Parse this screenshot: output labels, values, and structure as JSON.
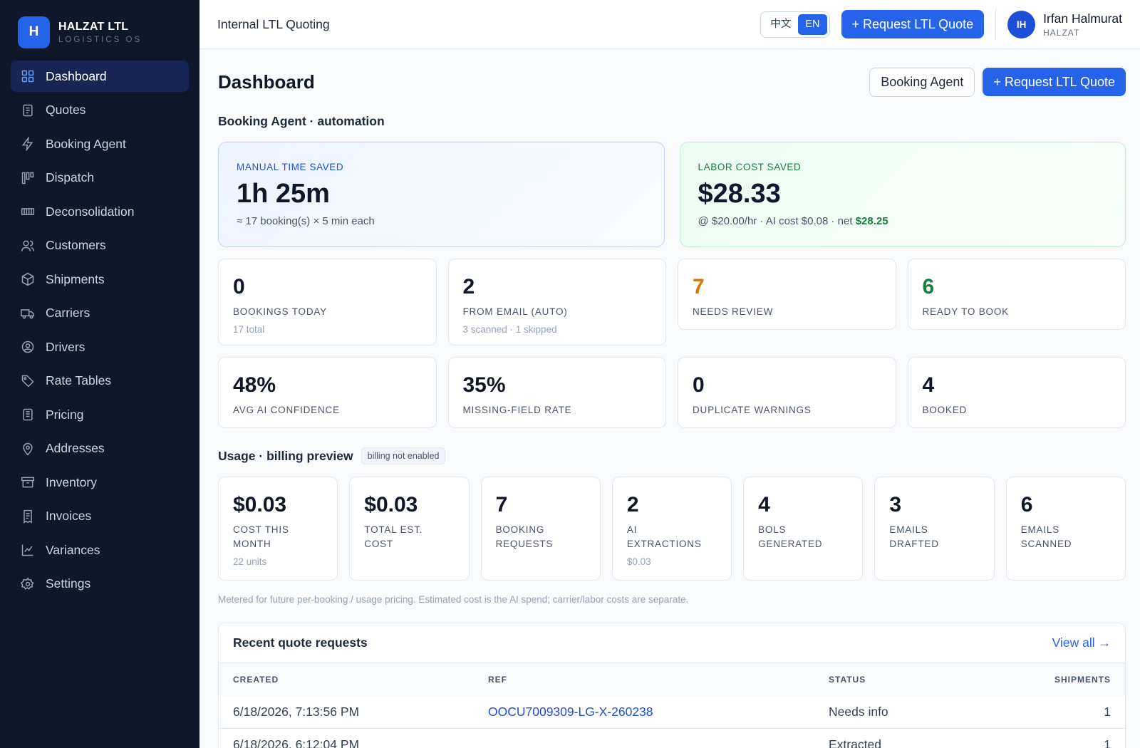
{
  "brand": {
    "logo_letter": "H",
    "name": "HALZAT LTL",
    "sub": "LOGISTICS OS"
  },
  "sidebar": {
    "items": [
      {
        "label": "Dashboard",
        "icon": "grid-icon",
        "active": true
      },
      {
        "label": "Quotes",
        "icon": "document-icon"
      },
      {
        "label": "Booking Agent",
        "icon": "lightning-icon"
      },
      {
        "label": "Dispatch",
        "icon": "kanban-icon"
      },
      {
        "label": "Deconsolidation",
        "icon": "barcode-icon"
      },
      {
        "label": "Customers",
        "icon": "users-icon"
      },
      {
        "label": "Shipments",
        "icon": "box-icon"
      },
      {
        "label": "Carriers",
        "icon": "truck-icon"
      },
      {
        "label": "Drivers",
        "icon": "driver-icon"
      },
      {
        "label": "Rate Tables",
        "icon": "tag-icon"
      },
      {
        "label": "Pricing",
        "icon": "list-icon"
      },
      {
        "label": "Addresses",
        "icon": "pin-icon"
      },
      {
        "label": "Inventory",
        "icon": "archive-icon"
      },
      {
        "label": "Invoices",
        "icon": "receipt-icon"
      },
      {
        "label": "Variances",
        "icon": "line-chart-icon"
      },
      {
        "label": "Settings",
        "icon": "gear-icon"
      }
    ]
  },
  "topbar": {
    "title": "Internal LTL Quoting",
    "lang_zh": "中文",
    "lang_en": "EN",
    "request_button": "+ Request LTL Quote",
    "user": {
      "initials": "IH",
      "name": "Irfan Halmurat",
      "org": "HALZAT"
    }
  },
  "page": {
    "title": "Dashboard",
    "booking_agent_button": "Booking Agent",
    "request_button": "+ Request LTL Quote",
    "automation_title": "Booking Agent · automation",
    "hero": {
      "time": {
        "label": "MANUAL TIME SAVED",
        "value": "1h 25m",
        "sub": "≈ 17 booking(s) × 5 min each"
      },
      "cost": {
        "label": "LABOR COST SAVED",
        "value": "$28.33",
        "sub": "@ $20.00/hr · AI cost $0.08 · net ",
        "net": "$28.25"
      }
    },
    "stats_row1": [
      {
        "value": "0",
        "label": "Bookings today",
        "sub": "17 total",
        "color": "#0f172a"
      },
      {
        "value": "2",
        "label": "From email (auto)",
        "sub": "3 scanned · 1 skipped",
        "color": "#0f172a"
      },
      {
        "value": "7",
        "label": "Needs review",
        "sub": "",
        "color": "#d97706"
      },
      {
        "value": "6",
        "label": "Ready to book",
        "sub": "",
        "color": "#15803d"
      }
    ],
    "stats_row2": [
      {
        "value": "48%",
        "label": "Avg AI confidence"
      },
      {
        "value": "35%",
        "label": "Missing-field rate"
      },
      {
        "value": "0",
        "label": "Duplicate warnings"
      },
      {
        "value": "4",
        "label": "Booked"
      }
    ],
    "usage_title": "Usage · billing preview",
    "usage_badge": "billing not enabled",
    "usage": [
      {
        "value": "$0.03",
        "label": "Cost this month",
        "sub": "22 units"
      },
      {
        "value": "$0.03",
        "label": "Total est. cost",
        "sub": ""
      },
      {
        "value": "7",
        "label": "Booking requests",
        "sub": ""
      },
      {
        "value": "2",
        "label": "AI extractions",
        "sub": "$0.03"
      },
      {
        "value": "4",
        "label": "BOLs generated",
        "sub": ""
      },
      {
        "value": "3",
        "label": "Emails drafted",
        "sub": ""
      },
      {
        "value": "6",
        "label": "Emails scanned",
        "sub": ""
      }
    ],
    "usage_note": "Metered for future per-booking / usage pricing. Estimated cost is the AI spend; carrier/labor costs are separate.",
    "recent": {
      "title": "Recent quote requests",
      "view_all": "View all →",
      "columns": [
        "CREATED",
        "REF",
        "STATUS",
        "SHIPMENTS"
      ],
      "rows": [
        {
          "created": "6/18/2026, 7:13:56 PM",
          "ref": "OOCU7009309-LG-X-260238",
          "status": "Needs info",
          "shipments": "1"
        },
        {
          "created": "6/18/2026, 6:12:04 PM",
          "ref": "",
          "status": "Extracted",
          "shipments": "1"
        }
      ]
    }
  }
}
